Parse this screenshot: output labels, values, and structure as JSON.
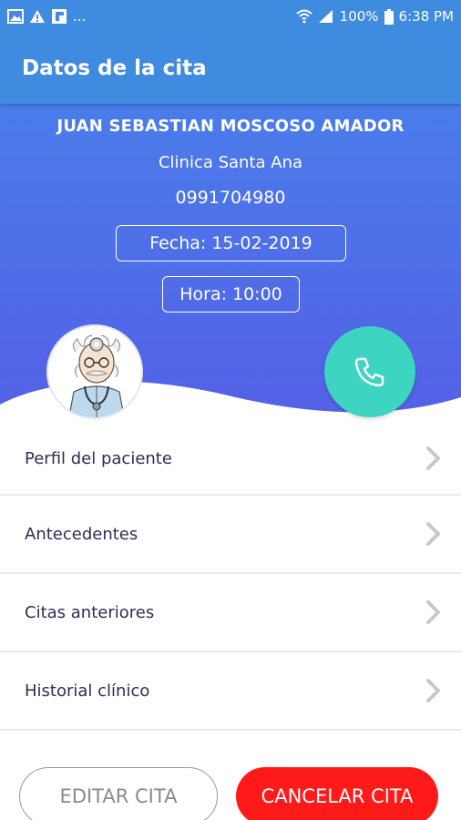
{
  "status_bar": {
    "overflow": "...",
    "battery": "100%",
    "time": "6:38 PM",
    "icons": [
      "image-icon",
      "warning-icon",
      "flipboard-icon",
      "wifi-icon",
      "signal-icon",
      "battery-icon"
    ]
  },
  "app_bar": {
    "title": "Datos de la cita"
  },
  "appointment": {
    "patient_name": "JUAN SEBASTIAN MOSCOSO AMADOR",
    "clinic": "Clinica Santa Ana",
    "phone": "0991704980",
    "date_label": "Fecha:",
    "date_value": "15-02-2019",
    "time_label": "Hora:",
    "time_value": "10:00"
  },
  "menu": {
    "items": [
      {
        "label": "Perfil del paciente"
      },
      {
        "label": "Antecedentes"
      },
      {
        "label": "Citas anteriores"
      },
      {
        "label": "Historial clínico"
      }
    ]
  },
  "actions": {
    "edit_label": "EDITAR CITA",
    "cancel_label": "CANCELAR CITA"
  },
  "colors": {
    "primary": "#3f8be0",
    "gradient_top": "#4a7cea",
    "gradient_bottom": "#5460e6",
    "call_button": "#3ed4c2",
    "cancel_button": "#ff1a1a",
    "menu_text": "#2a2f52"
  }
}
